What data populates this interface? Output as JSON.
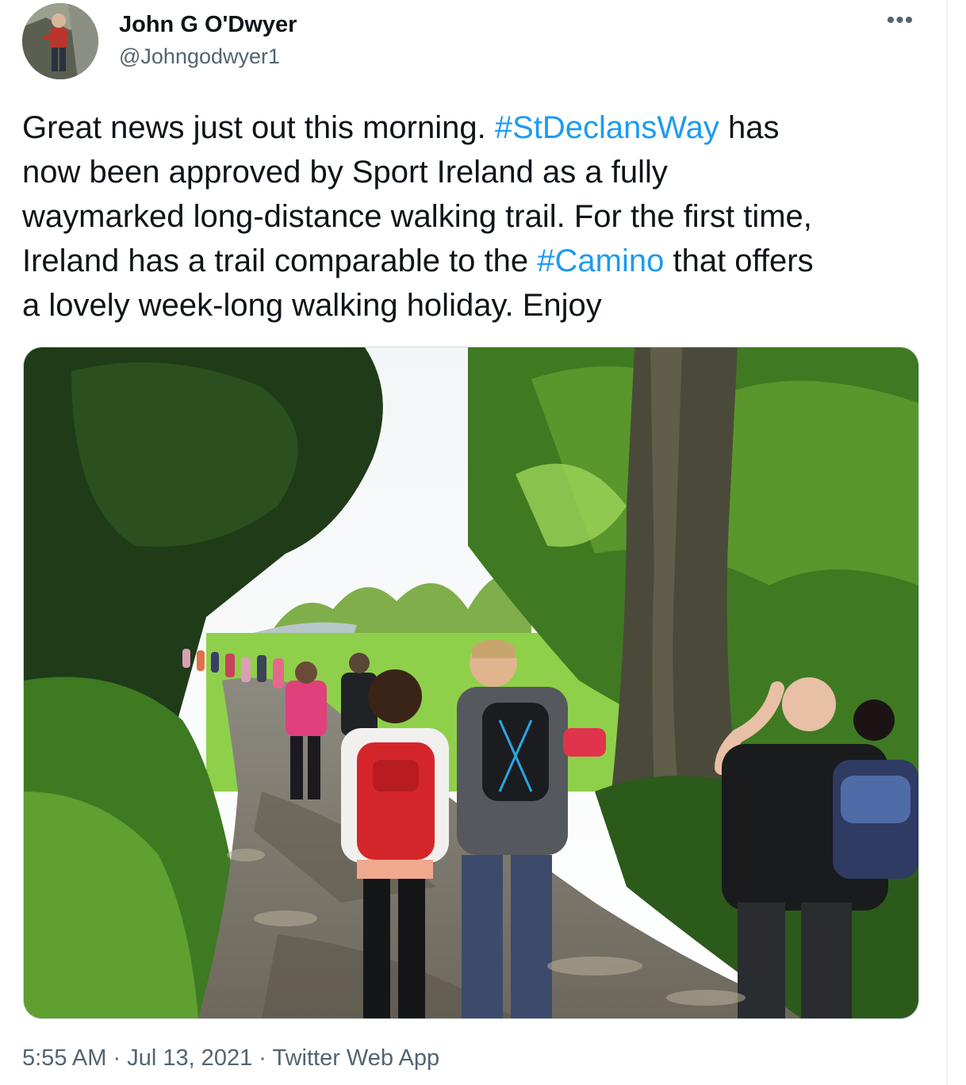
{
  "author": {
    "display_name": "John G O'Dwyer",
    "handle": "@Johngodwyer1",
    "avatar_icon": "user-avatar-photo"
  },
  "menu": {
    "icon": "more-options-icon",
    "label": "•••"
  },
  "tweet": {
    "text_part_1": "Great news just out this morning. ",
    "hashtag_1": "#StDeclansWay",
    "text_part_2": " has\nnow been approved by Sport Ireland as a fully\nwaymarked long-distance walking trail. For the first time,\nIreland has a trail comparable to the ",
    "hashtag_2": "#Camino",
    "text_part_3": " that offers\na lovely week-long walking holiday. Enjoy"
  },
  "media": {
    "type": "photo",
    "icon": "walkers-on-forest-trail-photo"
  },
  "meta": {
    "time": "5:55 AM",
    "separator_1": " · ",
    "date": "Jul 13, 2021",
    "separator_2": " · ",
    "source": "Twitter Web App"
  },
  "colors": {
    "link": "#1d9bf0",
    "secondary_text": "#536471",
    "primary_text": "#0f1419"
  }
}
